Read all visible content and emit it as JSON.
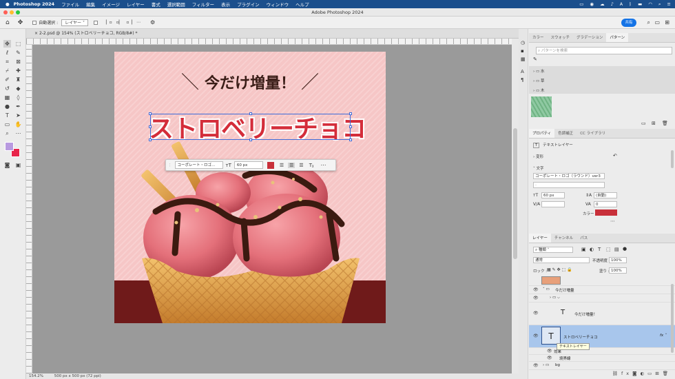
{
  "menubar": {
    "app_name": "Photoshop 2024",
    "items": [
      "ファイル",
      "編集",
      "イメージ",
      "レイヤー",
      "書式",
      "選択範囲",
      "フィルター",
      "表示",
      "プラグイン",
      "ウィンドウ",
      "ヘルプ"
    ]
  },
  "window": {
    "title": "Adobe Photoshop 2024"
  },
  "options_bar": {
    "auto_select_label": "自動選択 :",
    "auto_select_value": "レイヤー",
    "share_label": "共有"
  },
  "document": {
    "tab_label": "2-2.psd @ 154% (ストロベリーチョコ, RGB/8#) *"
  },
  "status": {
    "zoom": "154.2%",
    "doc_size": "500 px x 500 px (72 ppi)"
  },
  "canvas": {
    "headline": "今だけ増量！",
    "title": "ストロベリーチョコ"
  },
  "context_bar": {
    "font": "コーポレート・ロゴ...",
    "size": "60 px",
    "color": "#c8303a"
  },
  "swatches": {
    "tabs": [
      "カラー",
      "スウォッチ",
      "グラデーション",
      "パターン"
    ],
    "active_tab": "パターン",
    "search_placeholder": "パターンを検索",
    "folders": [
      "水",
      "草",
      "木"
    ]
  },
  "properties": {
    "tabs": [
      "プロパティ",
      "色調補正",
      "CC ライブラリ"
    ],
    "layer_type": "テキストレイヤー",
    "transform_label": "変形",
    "character_label": "文字",
    "font": "コーポレート・ロゴ（ラウンド）ver3",
    "size": "60 px",
    "leading": "(自動)",
    "tracking": "0",
    "color_label": "カラー",
    "color": "#c8303a"
  },
  "layers": {
    "tabs": [
      "レイヤー",
      "チャンネル",
      "パス"
    ],
    "filter_label": "種類",
    "blend_mode": "通常",
    "opacity_label": "不透明度 :",
    "opacity": "100%",
    "lock_label": "ロック :",
    "fill_label": "塗り :",
    "fill": "100%",
    "rows": [
      {
        "name": "今だけ増量"
      },
      {
        "name": "今だけ増量！"
      },
      {
        "name": "ストロベリーチョコ"
      },
      {
        "name": "効果"
      },
      {
        "name": "境界線"
      },
      {
        "name": "bg"
      }
    ],
    "tooltip": "テキストレイヤー"
  },
  "colors": {
    "foreground": "#b89ae0",
    "background": "#e8254a",
    "menubar": "#1b4f8c",
    "selection": "#a8c6ec"
  }
}
